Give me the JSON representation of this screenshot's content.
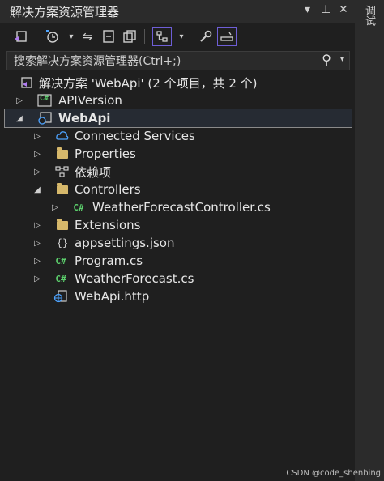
{
  "window": {
    "title": "解决方案资源管理器",
    "dropdown_icon": "chevron-down-icon",
    "pin_icon": "pin-icon",
    "close_icon": "close-icon"
  },
  "toolbar": {
    "buttons": [
      {
        "name": "switch-views-icon"
      },
      {
        "name": "history-icon"
      },
      {
        "name": "sync-icon"
      },
      {
        "name": "collapse-all-icon"
      },
      {
        "name": "show-all-files-icon"
      },
      {
        "name": "tracking-icon"
      },
      {
        "name": "properties-wrench-icon"
      },
      {
        "name": "preview-icon"
      }
    ]
  },
  "search": {
    "placeholder": "搜索解决方案资源管理器(Ctrl+;)"
  },
  "tree": {
    "solution": "解决方案 'WebApi' (2 个项目，共 2 个)",
    "items": [
      {
        "label": "APIVersion"
      },
      {
        "label": "WebApi"
      },
      {
        "label": "Connected Services"
      },
      {
        "label": "Properties"
      },
      {
        "label": "依赖项"
      },
      {
        "label": "Controllers"
      },
      {
        "label": "WeatherForecastController.cs"
      },
      {
        "label": "Extensions"
      },
      {
        "label": "appsettings.json"
      },
      {
        "label": "Program.cs"
      },
      {
        "label": "WeatherForecast.cs"
      },
      {
        "label": "WebApi.http"
      }
    ]
  },
  "side_tab": {
    "label": "调试"
  },
  "watermark": "CSDN @code_shenbing",
  "colors": {
    "background": "#1f1f1f",
    "selection_border": "#8a8a8a",
    "accent": "#6e5ed6",
    "cs_green": "#5ccf6c",
    "folder": "#d6b86b"
  }
}
